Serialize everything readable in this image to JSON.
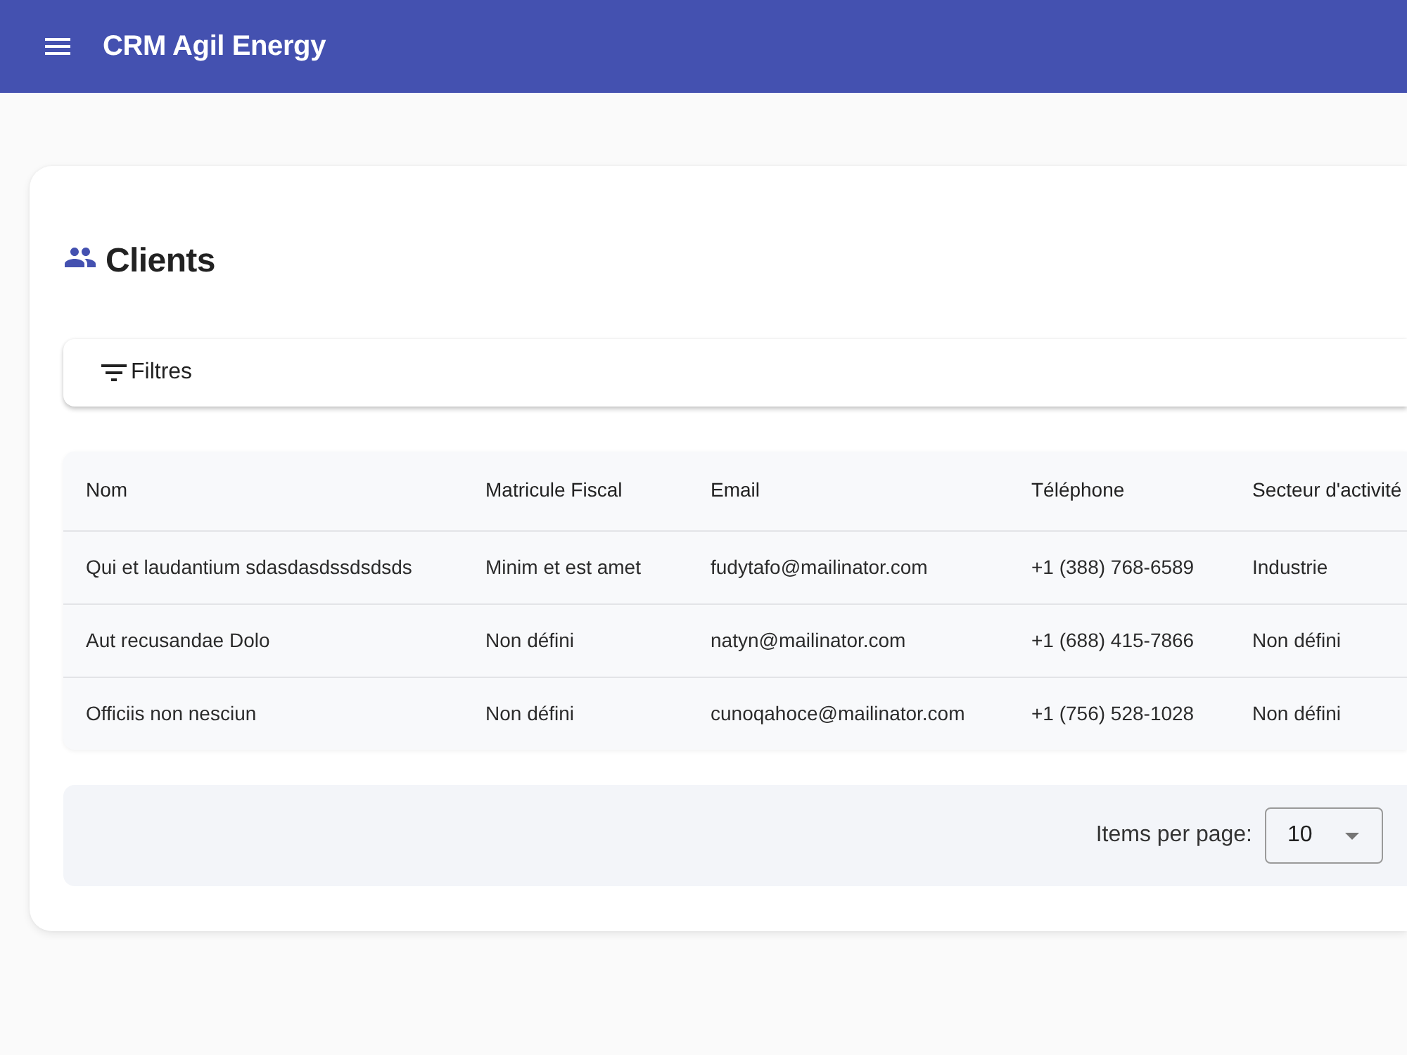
{
  "app_bar": {
    "title": "CRM Agil Energy"
  },
  "page": {
    "title": "Clients"
  },
  "filters": {
    "label": "Filtres"
  },
  "table": {
    "columns": [
      "Nom",
      "Matricule Fiscal",
      "Email",
      "Téléphone",
      "Secteur d'activité"
    ],
    "rows": [
      [
        "Qui et laudantium sdasdasdssdsdsds",
        "Minim et est amet",
        "fudytafo@mailinator.com",
        "+1 (388) 768-6589",
        "Industrie"
      ],
      [
        "Aut recusandae Dolo",
        "Non défini",
        "natyn@mailinator.com",
        "+1 (688) 415-7866",
        "Non défini"
      ],
      [
        "Officiis non nesciun",
        "Non défini",
        "cunoqahoce@mailinator.com",
        "+1 (756) 528-1028",
        "Non défini"
      ]
    ]
  },
  "paginator": {
    "label": "Items per page:",
    "page_size": "10"
  }
}
